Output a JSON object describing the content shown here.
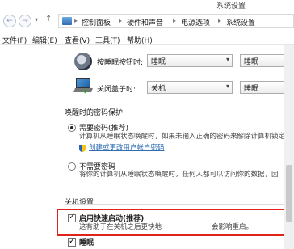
{
  "window": {
    "title": "系统设置"
  },
  "address": {
    "nav_back": "←",
    "nav_forward": "→",
    "nav_recent": "▾",
    "nav_up": "↑",
    "crumbs": [
      "控制面板",
      "硬件和声音",
      "电源选项",
      "系统设置"
    ],
    "separator": "▸"
  },
  "menu": [
    "文件(F)",
    "编辑(E)",
    "查看(V)",
    "工具(T)",
    "帮助(H)"
  ],
  "power_buttons": {
    "sleep_button_label": "按睡眠按钮时:",
    "sleep_button_value": "睡眠",
    "sleep_button_value_right": "睡眠",
    "lid_label": "关闭盖子时:",
    "lid_value": "关机",
    "lid_value_right": "睡眠"
  },
  "wake_password": {
    "title": "唤醒时的密码保护",
    "require_label": "需要密码(推荐)",
    "require_desc": "计算机从睡眠状态唤醒时，如果未输入正确的密码来解除计算机锁定，",
    "require_link": "创建或更改用户帐户密码",
    "no_require_label": "不需要密码",
    "no_require_desc": "将你的计算机从睡眠状态唤醒时，任何人都可以访问你的数据，因"
  },
  "shutdown_settings": {
    "title": "关机设置",
    "fast_startup_label": "启用快速启动(推荐)",
    "fast_startup_desc": "这有助于在关机之后更快地",
    "fast_startup_desc_right": "会影响重启。",
    "sleep_label": "睡眠"
  }
}
